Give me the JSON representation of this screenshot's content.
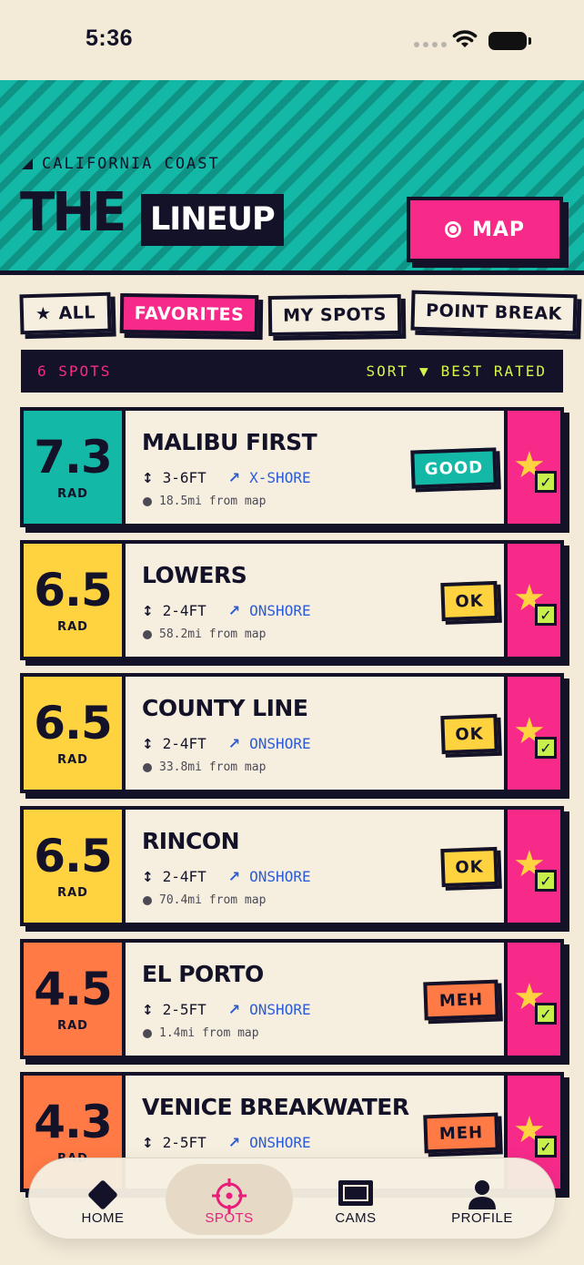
{
  "status": {
    "time": "5:36"
  },
  "header": {
    "region": "CALIFORNIA COAST",
    "title_part1": "THE",
    "title_part2": "LINEUP",
    "map_button": "MAP"
  },
  "filters": [
    {
      "label": "ALL",
      "icon": "star-icon",
      "active": false
    },
    {
      "label": "FAVORITES",
      "active": true
    },
    {
      "label": "MY SPOTS",
      "active": false
    },
    {
      "label": "POINT BREAK",
      "active": false
    }
  ],
  "sort_bar": {
    "count": "6 SPOTS",
    "sort_label": "SORT",
    "sort_value": "BEST RATED"
  },
  "spots": [
    {
      "score": "7.3",
      "unit": "RAD",
      "name": "MALIBU FIRST",
      "wave": "3-6FT",
      "wind": "X-SHORE",
      "distance": "18.5mi from map",
      "rating": "GOOD",
      "color": "#14b8a6",
      "badge_text_color": "#ffffff"
    },
    {
      "score": "6.5",
      "unit": "RAD",
      "name": "LOWERS",
      "wave": "2-4FT",
      "wind": "ONSHORE",
      "distance": "58.2mi from map",
      "rating": "OK",
      "color": "#ffd23f",
      "badge_text_color": "#131228"
    },
    {
      "score": "6.5",
      "unit": "RAD",
      "name": "COUNTY LINE",
      "wave": "2-4FT",
      "wind": "ONSHORE",
      "distance": "33.8mi from map",
      "rating": "OK",
      "color": "#ffd23f",
      "badge_text_color": "#131228"
    },
    {
      "score": "6.5",
      "unit": "RAD",
      "name": "RINCON",
      "wave": "2-4FT",
      "wind": "ONSHORE",
      "distance": "70.4mi from map",
      "rating": "OK",
      "color": "#ffd23f",
      "badge_text_color": "#131228"
    },
    {
      "score": "4.5",
      "unit": "RAD",
      "name": "EL PORTO",
      "wave": "2-5FT",
      "wind": "ONSHORE",
      "distance": "1.4mi from map",
      "rating": "MEH",
      "color": "#ff7a45",
      "badge_text_color": "#131228"
    },
    {
      "score": "4.3",
      "unit": "RAD",
      "name": "VENICE BREAKWATER",
      "wave": "2-5FT",
      "wind": "ONSHORE",
      "distance": "",
      "rating": "MEH",
      "color": "#ff7a45",
      "badge_text_color": "#131228"
    }
  ],
  "tabs": [
    {
      "label": "HOME",
      "icon": "home-diamond-icon",
      "active": false
    },
    {
      "label": "SPOTS",
      "icon": "crosshair-icon",
      "active": true
    },
    {
      "label": "CAMS",
      "icon": "camera-screen-icon",
      "active": false
    },
    {
      "label": "PROFILE",
      "icon": "person-icon",
      "active": false
    }
  ],
  "colors": {
    "teal": "#14b8a6",
    "pink": "#f72a8a",
    "yellow": "#ffd23f",
    "orange": "#ff7a45",
    "ink": "#131228",
    "lime": "#d6f34a",
    "cream": "#f3ead8",
    "wind_blue": "#2b5bd7"
  }
}
